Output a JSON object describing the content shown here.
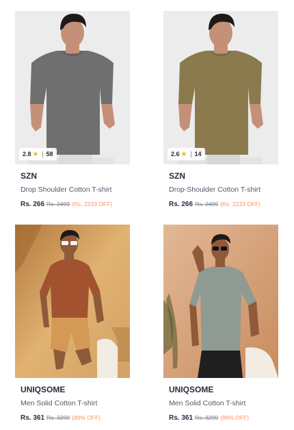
{
  "products": [
    {
      "brand": "SZN",
      "name": "Drop Shoulder Cotton T-shirt",
      "price": "Rs. 266",
      "mrp": "Rs. 2499",
      "discount": "(Rs. 2233 OFF)",
      "rating": "2.8",
      "rating_count": "58",
      "bg_color": "#ececec",
      "shirt_color": "#6f6f6f"
    },
    {
      "brand": "SZN",
      "name": "Drop-Shoulder Cotton T-shirt",
      "price": "Rs. 266",
      "mrp": "Rs. 2499",
      "discount": "(Rs. 2233 OFF)",
      "rating": "2.6",
      "rating_count": "14",
      "bg_color": "#ececec",
      "shirt_color": "#8a7a4e"
    },
    {
      "brand": "UNIQSOME",
      "name": "Men Solid Cotton T-shirt",
      "price": "Rs. 361",
      "mrp": "Rs. 3299",
      "discount": "(89% OFF)",
      "bg_color": "#d9a86a",
      "shirt_color": "#a3522f",
      "shorts_color": "#d49a55"
    },
    {
      "brand": "UNIQSOME",
      "name": "Men Solid Cotton T-shirt",
      "price": "Rs. 361",
      "mrp": "Rs. 3299",
      "discount": "(89% OFF)",
      "bg_color": "#d6a47c",
      "shirt_color": "#8f9a93",
      "pants_color": "#1f1f1f"
    }
  ]
}
